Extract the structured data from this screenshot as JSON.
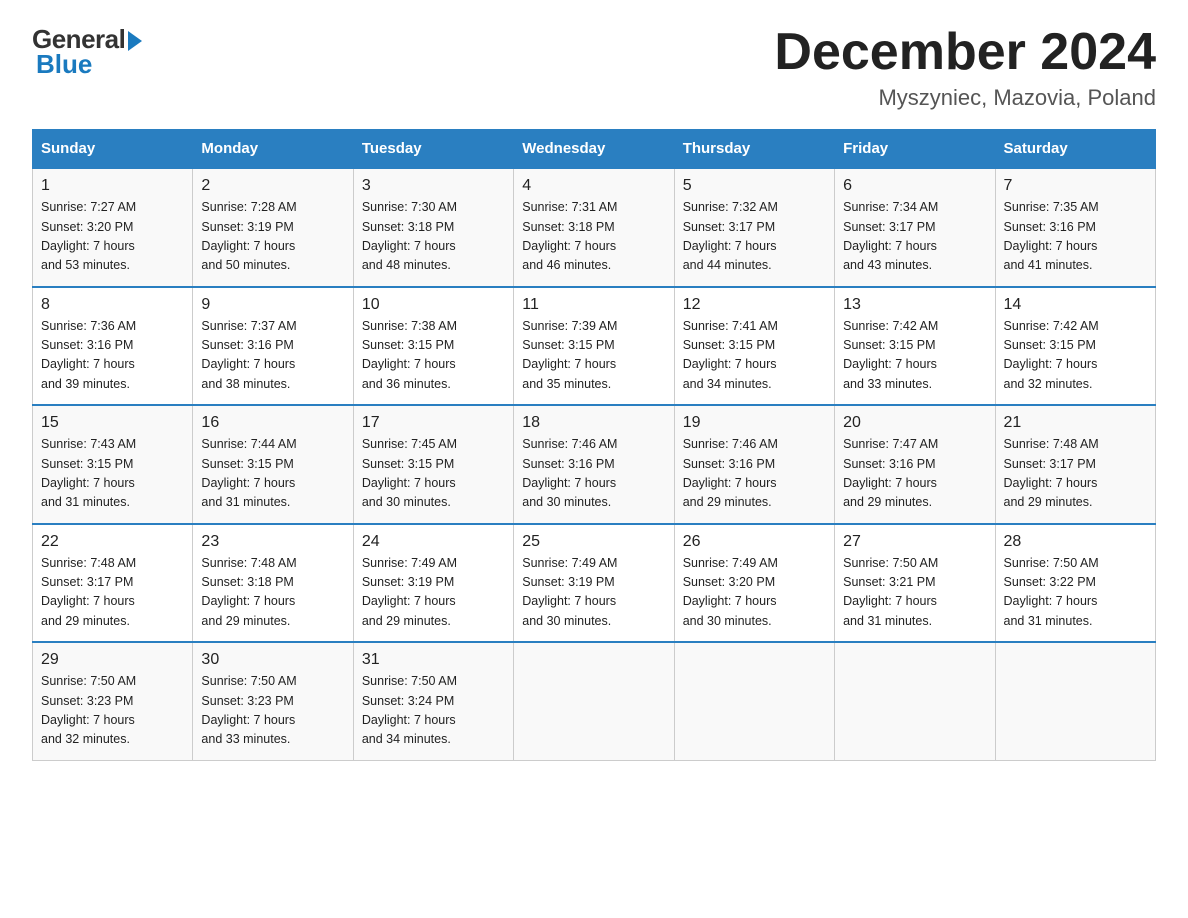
{
  "logo": {
    "general": "General",
    "blue": "Blue"
  },
  "title": "December 2024",
  "location": "Myszyniec, Mazovia, Poland",
  "days_of_week": [
    "Sunday",
    "Monday",
    "Tuesday",
    "Wednesday",
    "Thursday",
    "Friday",
    "Saturday"
  ],
  "weeks": [
    [
      {
        "day": "1",
        "sunrise": "7:27 AM",
        "sunset": "3:20 PM",
        "daylight": "7 hours and 53 minutes."
      },
      {
        "day": "2",
        "sunrise": "7:28 AM",
        "sunset": "3:19 PM",
        "daylight": "7 hours and 50 minutes."
      },
      {
        "day": "3",
        "sunrise": "7:30 AM",
        "sunset": "3:18 PM",
        "daylight": "7 hours and 48 minutes."
      },
      {
        "day": "4",
        "sunrise": "7:31 AM",
        "sunset": "3:18 PM",
        "daylight": "7 hours and 46 minutes."
      },
      {
        "day": "5",
        "sunrise": "7:32 AM",
        "sunset": "3:17 PM",
        "daylight": "7 hours and 44 minutes."
      },
      {
        "day": "6",
        "sunrise": "7:34 AM",
        "sunset": "3:17 PM",
        "daylight": "7 hours and 43 minutes."
      },
      {
        "day": "7",
        "sunrise": "7:35 AM",
        "sunset": "3:16 PM",
        "daylight": "7 hours and 41 minutes."
      }
    ],
    [
      {
        "day": "8",
        "sunrise": "7:36 AM",
        "sunset": "3:16 PM",
        "daylight": "7 hours and 39 minutes."
      },
      {
        "day": "9",
        "sunrise": "7:37 AM",
        "sunset": "3:16 PM",
        "daylight": "7 hours and 38 minutes."
      },
      {
        "day": "10",
        "sunrise": "7:38 AM",
        "sunset": "3:15 PM",
        "daylight": "7 hours and 36 minutes."
      },
      {
        "day": "11",
        "sunrise": "7:39 AM",
        "sunset": "3:15 PM",
        "daylight": "7 hours and 35 minutes."
      },
      {
        "day": "12",
        "sunrise": "7:41 AM",
        "sunset": "3:15 PM",
        "daylight": "7 hours and 34 minutes."
      },
      {
        "day": "13",
        "sunrise": "7:42 AM",
        "sunset": "3:15 PM",
        "daylight": "7 hours and 33 minutes."
      },
      {
        "day": "14",
        "sunrise": "7:42 AM",
        "sunset": "3:15 PM",
        "daylight": "7 hours and 32 minutes."
      }
    ],
    [
      {
        "day": "15",
        "sunrise": "7:43 AM",
        "sunset": "3:15 PM",
        "daylight": "7 hours and 31 minutes."
      },
      {
        "day": "16",
        "sunrise": "7:44 AM",
        "sunset": "3:15 PM",
        "daylight": "7 hours and 31 minutes."
      },
      {
        "day": "17",
        "sunrise": "7:45 AM",
        "sunset": "3:15 PM",
        "daylight": "7 hours and 30 minutes."
      },
      {
        "day": "18",
        "sunrise": "7:46 AM",
        "sunset": "3:16 PM",
        "daylight": "7 hours and 30 minutes."
      },
      {
        "day": "19",
        "sunrise": "7:46 AM",
        "sunset": "3:16 PM",
        "daylight": "7 hours and 29 minutes."
      },
      {
        "day": "20",
        "sunrise": "7:47 AM",
        "sunset": "3:16 PM",
        "daylight": "7 hours and 29 minutes."
      },
      {
        "day": "21",
        "sunrise": "7:48 AM",
        "sunset": "3:17 PM",
        "daylight": "7 hours and 29 minutes."
      }
    ],
    [
      {
        "day": "22",
        "sunrise": "7:48 AM",
        "sunset": "3:17 PM",
        "daylight": "7 hours and 29 minutes."
      },
      {
        "day": "23",
        "sunrise": "7:48 AM",
        "sunset": "3:18 PM",
        "daylight": "7 hours and 29 minutes."
      },
      {
        "day": "24",
        "sunrise": "7:49 AM",
        "sunset": "3:19 PM",
        "daylight": "7 hours and 29 minutes."
      },
      {
        "day": "25",
        "sunrise": "7:49 AM",
        "sunset": "3:19 PM",
        "daylight": "7 hours and 30 minutes."
      },
      {
        "day": "26",
        "sunrise": "7:49 AM",
        "sunset": "3:20 PM",
        "daylight": "7 hours and 30 minutes."
      },
      {
        "day": "27",
        "sunrise": "7:50 AM",
        "sunset": "3:21 PM",
        "daylight": "7 hours and 31 minutes."
      },
      {
        "day": "28",
        "sunrise": "7:50 AM",
        "sunset": "3:22 PM",
        "daylight": "7 hours and 31 minutes."
      }
    ],
    [
      {
        "day": "29",
        "sunrise": "7:50 AM",
        "sunset": "3:23 PM",
        "daylight": "7 hours and 32 minutes."
      },
      {
        "day": "30",
        "sunrise": "7:50 AM",
        "sunset": "3:23 PM",
        "daylight": "7 hours and 33 minutes."
      },
      {
        "day": "31",
        "sunrise": "7:50 AM",
        "sunset": "3:24 PM",
        "daylight": "7 hours and 34 minutes."
      },
      null,
      null,
      null,
      null
    ]
  ],
  "labels": {
    "sunrise": "Sunrise:",
    "sunset": "Sunset:",
    "daylight": "Daylight:"
  }
}
